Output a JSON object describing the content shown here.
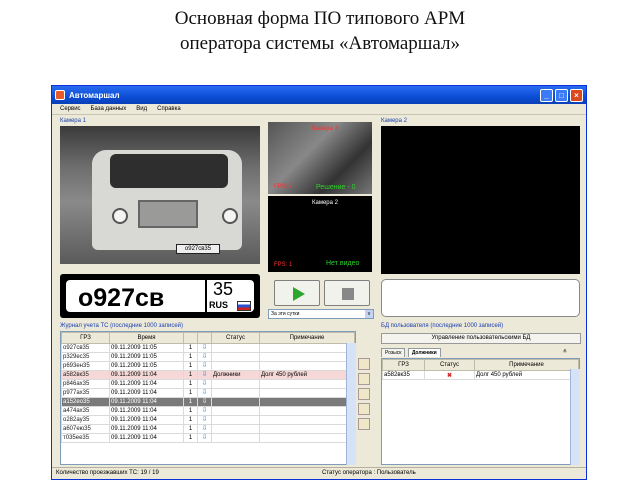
{
  "heading": {
    "line1": "Основная форма ПО типового АРМ",
    "line2": "оператора системы «Автомаршал»"
  },
  "window": {
    "title": "Автомаршал",
    "min_label": "_",
    "max_label": "□",
    "close_label": "×"
  },
  "menu": [
    "Сервис",
    "База данных",
    "Вид",
    "Справка"
  ],
  "camera1": {
    "label": "Камера 1",
    "small_plate": "о927св35"
  },
  "plate": {
    "number": "о927св",
    "region": "35",
    "country": "RUS"
  },
  "camera3": {
    "label": "Камера 3",
    "fps": "FPS: 7",
    "decision": "Решение - 0"
  },
  "camera2_small": {
    "label": "Камера 2",
    "fps": "FPS: 1",
    "no_video": "Нет видео"
  },
  "camera2": {
    "label": "Камера 2"
  },
  "combo": {
    "value": "За эти сутки",
    "arrow": "v"
  },
  "journal": {
    "title": "Журнал учета ТС (последние 1000 записей)",
    "columns": [
      "ГРЗ",
      "Время",
      "",
      "Статус",
      "Примечание"
    ],
    "rows": [
      {
        "plate": "о927св35",
        "time": "09.11.2009 11:05",
        "n": "1",
        "arrow": "⇩",
        "status": "",
        "note": "",
        "cls": ""
      },
      {
        "plate": "р329ес35",
        "time": "09.11.2009 11:05",
        "n": "1",
        "arrow": "⇩",
        "status": "",
        "note": "",
        "cls": ""
      },
      {
        "plate": "р693ен35",
        "time": "09.11.2009 11:05",
        "n": "1",
        "arrow": "⇩",
        "status": "",
        "note": "",
        "cls": ""
      },
      {
        "plate": "а582вк35",
        "time": "09.11.2009 11:04",
        "n": "1",
        "arrow": "⇩",
        "status": "Должники",
        "note": "Долг 450 рублей",
        "cls": "red"
      },
      {
        "plate": "р846ах35",
        "time": "09.11.2009 11:04",
        "n": "1",
        "arrow": "⇩",
        "status": "",
        "note": "",
        "cls": ""
      },
      {
        "plate": "р977ах35",
        "time": "09.11.2009 11:04",
        "n": "1",
        "arrow": "⇩",
        "status": "",
        "note": "",
        "cls": ""
      },
      {
        "plate": "а152ео35",
        "time": "09.11.2009 11:04",
        "n": "1",
        "arrow": "⇩",
        "status": "",
        "note": "",
        "cls": "sel"
      },
      {
        "plate": "а474ах35",
        "time": "09.11.2009 11:04",
        "n": "1",
        "arrow": "⇩",
        "status": "",
        "note": "",
        "cls": ""
      },
      {
        "plate": "о282ау35",
        "time": "09.11.2009 11:04",
        "n": "1",
        "arrow": "⇩",
        "status": "",
        "note": "",
        "cls": ""
      },
      {
        "plate": "а607ею35",
        "time": "09.11.2009 11:04",
        "n": "1",
        "arrow": "⇩",
        "status": "",
        "note": "",
        "cls": ""
      },
      {
        "plate": "т035ее35",
        "time": "09.11.2009 11:04",
        "n": "1",
        "arrow": "⇩",
        "status": "",
        "note": "",
        "cls": ""
      }
    ]
  },
  "db": {
    "title": "БД пользователя (последние 1000 записей)",
    "manage": "Управление пользовательскими БД",
    "tabs": [
      "Розыск",
      "Должники"
    ],
    "tabs_arrow": "≚",
    "columns": [
      "ГРЗ",
      "Статус",
      "Примечание"
    ],
    "rows": [
      {
        "plate": "а582вк35",
        "status": "✖",
        "note": "Долг 450 рублей"
      }
    ]
  },
  "statusbar": {
    "count": "Количество проезжавших ТС: 19 / 19",
    "operator": "Статус оператора : Пользователь"
  }
}
